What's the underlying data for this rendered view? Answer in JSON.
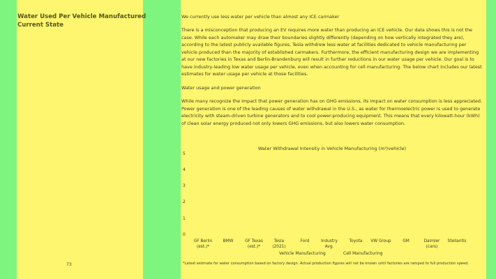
{
  "left": {
    "title_line1": "Water Used Per Vehicle Manufactured",
    "title_line2": "Current State",
    "page_number": "73"
  },
  "main": {
    "heading": "We currently use less water per vehicle than almost any ICE carmaker",
    "para1": "There is a misconception that producing an EV requires more water than producing an ICE vehicle. Our data shows this is not the case. While each automaker may draw their boundaries slightly differently (depending on how vertically integrated they are), according to the latest publicly available figures, Tesla withdrew less water at facilities dedicated to vehicle manufacturing per vehicle produced than the majority of established carmakers. Furthermore, the efficient manufacturing design we are implementing at our new factories in Texas and Berlin-Brandenburg will result in further reductions in our water usage per vehicle. Our goal is to have industry-leading low water usage per vehicle, even when accounting for cell manufacturing. The below chart includes our latest estimates for water usage per vehicle at those facilities.",
    "subheading": "Water usage and power generation",
    "para2": "While many recognize the impact that power generation has on GHG emissions, its impact on water consumption is less appreciated. Power generation is one of the leading causes of water withdrawal in the U.S., as water for thermoelectric power is used to generate electricity with steam-driven turbine generators and to cool power-producing equipment. This means that every kilowatt-hour (kWh) of clean solar energy produced not only lowers GHG emissions, but also lowers water consumption."
  },
  "chart_data": {
    "type": "bar",
    "title": "Water Withdrawal Intensity in Vehicle Manufacturing (m³/vehicle)",
    "ylim": [
      0,
      5
    ],
    "yticks": [
      "0",
      "1",
      "2",
      "3",
      "4",
      "5"
    ],
    "categories": [
      {
        "l1": "GF Berlin",
        "l2": "(est.)*"
      },
      {
        "l1": "BMW",
        "l2": ""
      },
      {
        "l1": "GF Texas",
        "l2": "(est.)*"
      },
      {
        "l1": "Tesla",
        "l2": "(2021)"
      },
      {
        "l1": "Ford",
        "l2": ""
      },
      {
        "l1": "Industry",
        "l2": "Avg."
      },
      {
        "l1": "Toyota",
        "l2": ""
      },
      {
        "l1": "VW Group",
        "l2": ""
      },
      {
        "l1": "GM",
        "l2": ""
      },
      {
        "l1": "Daimler",
        "l2": "(cars)"
      },
      {
        "l1": "Stellantis",
        "l2": ""
      }
    ],
    "xlabel_left": "Vehicle Manufacturing",
    "xlabel_right": "Cell Manufacturing"
  },
  "footnote": "*Latest estimate for water consumption based on factory design. Actual production figures will not be known until factories are ramped to full production speed."
}
